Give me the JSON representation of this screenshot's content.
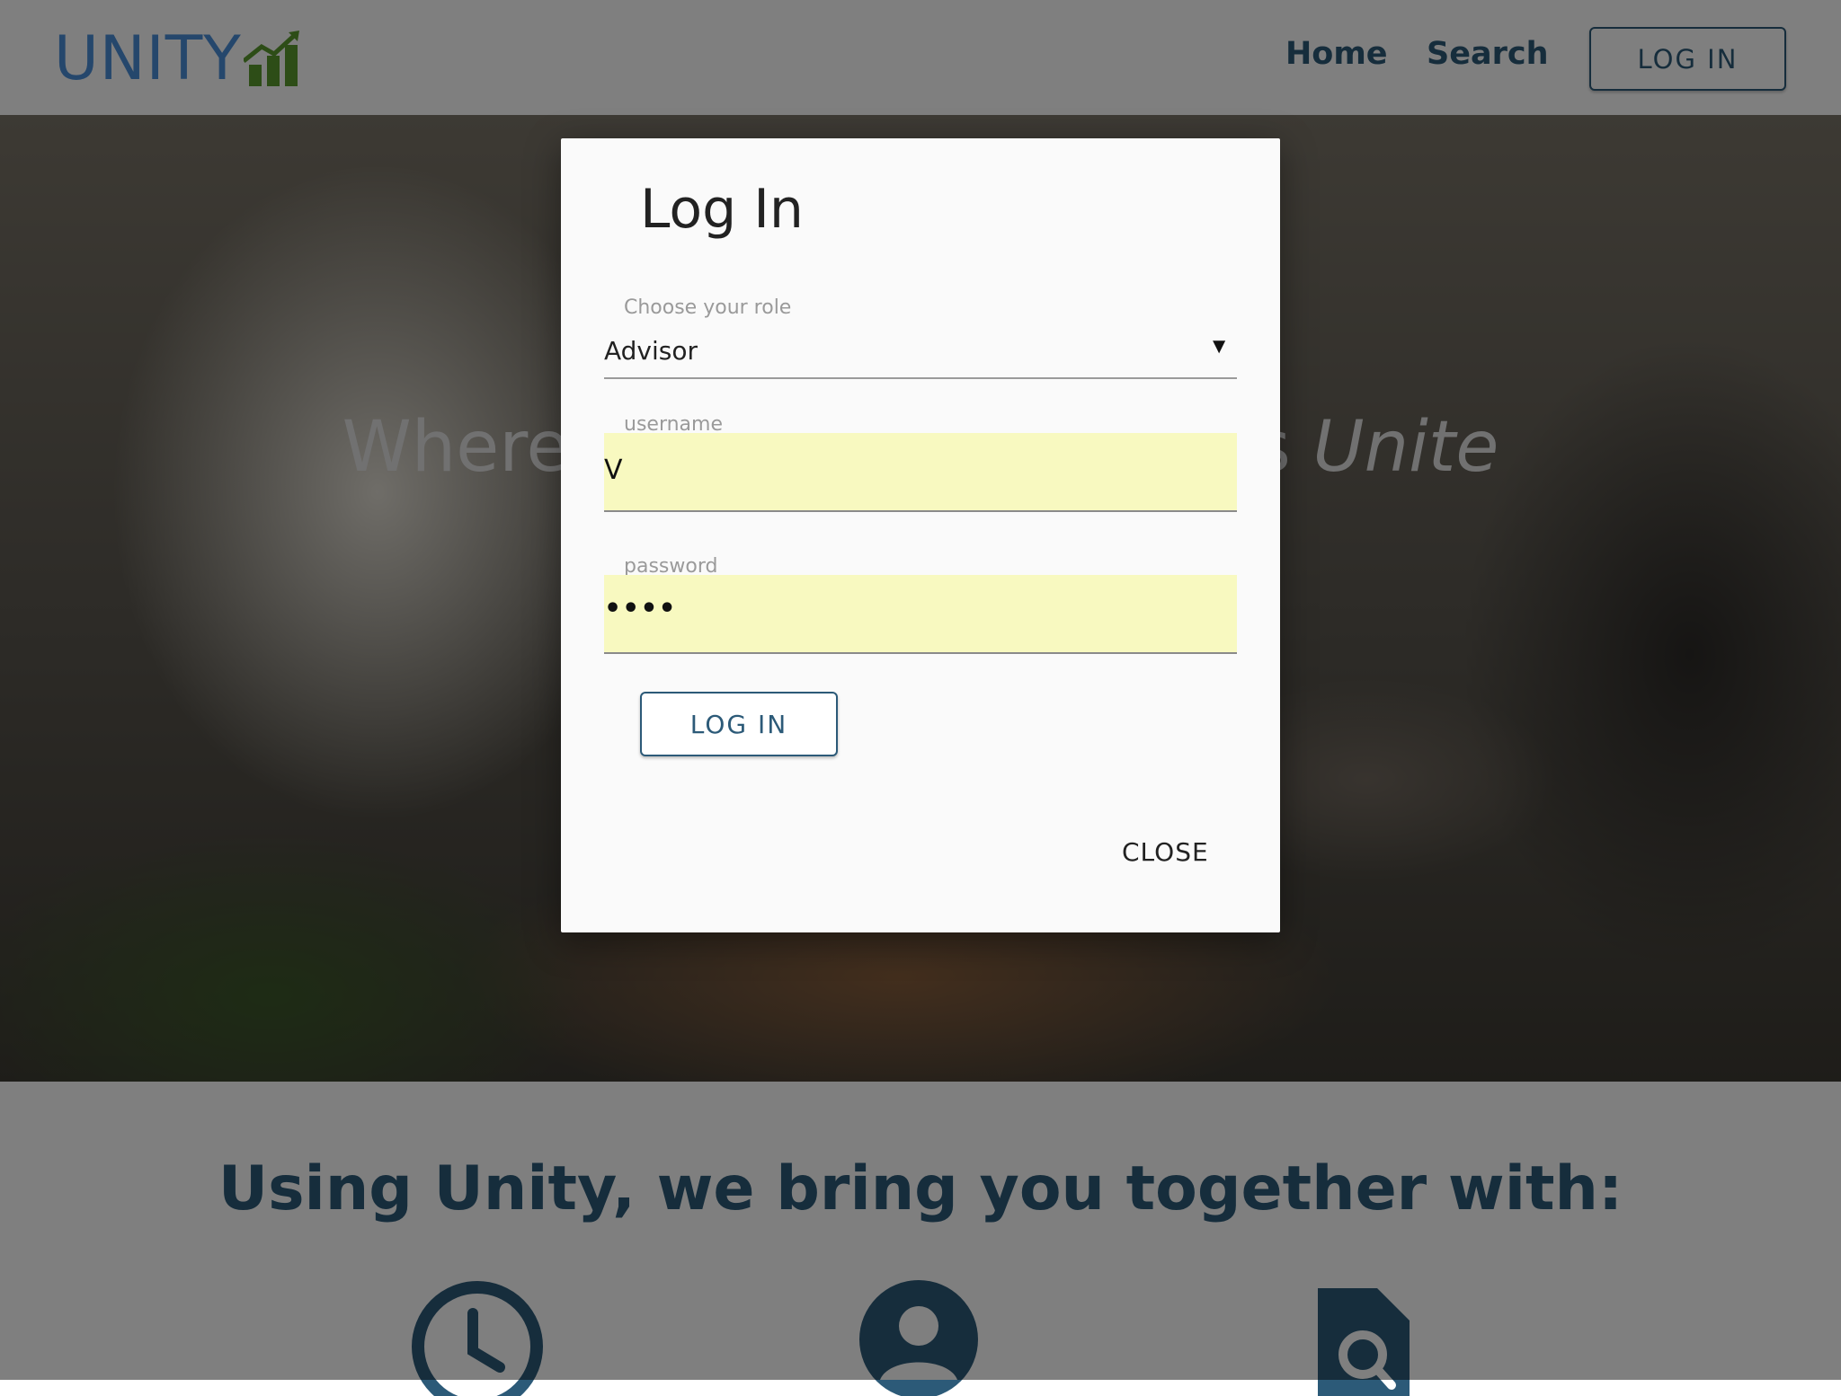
{
  "header": {
    "logo_text": "UNITY",
    "nav": {
      "home": "Home",
      "search": "Search"
    },
    "login_button": "LOG IN"
  },
  "hero": {
    "tagline_prefix": "Where clients and advisors ",
    "tagline_emphasis": "Unite"
  },
  "features": {
    "title": "Using Unity, we bring you together with:",
    "icons": [
      "clock-icon",
      "person-icon",
      "document-search-icon"
    ]
  },
  "modal": {
    "title": "Log In",
    "role_label": "Choose your role",
    "role_value": "Advisor",
    "role_arrow": "▼",
    "username_label": "username",
    "username_value": "V",
    "password_label": "password",
    "password_value": "••••",
    "login_button": "LOG IN",
    "close_button": "CLOSE"
  },
  "colors": {
    "brand_blue": "#4a8fd9",
    "brand_green": "#5a9a2e",
    "nav_blue": "#2c5a78",
    "autofill_yellow": "#f8f9c0"
  }
}
